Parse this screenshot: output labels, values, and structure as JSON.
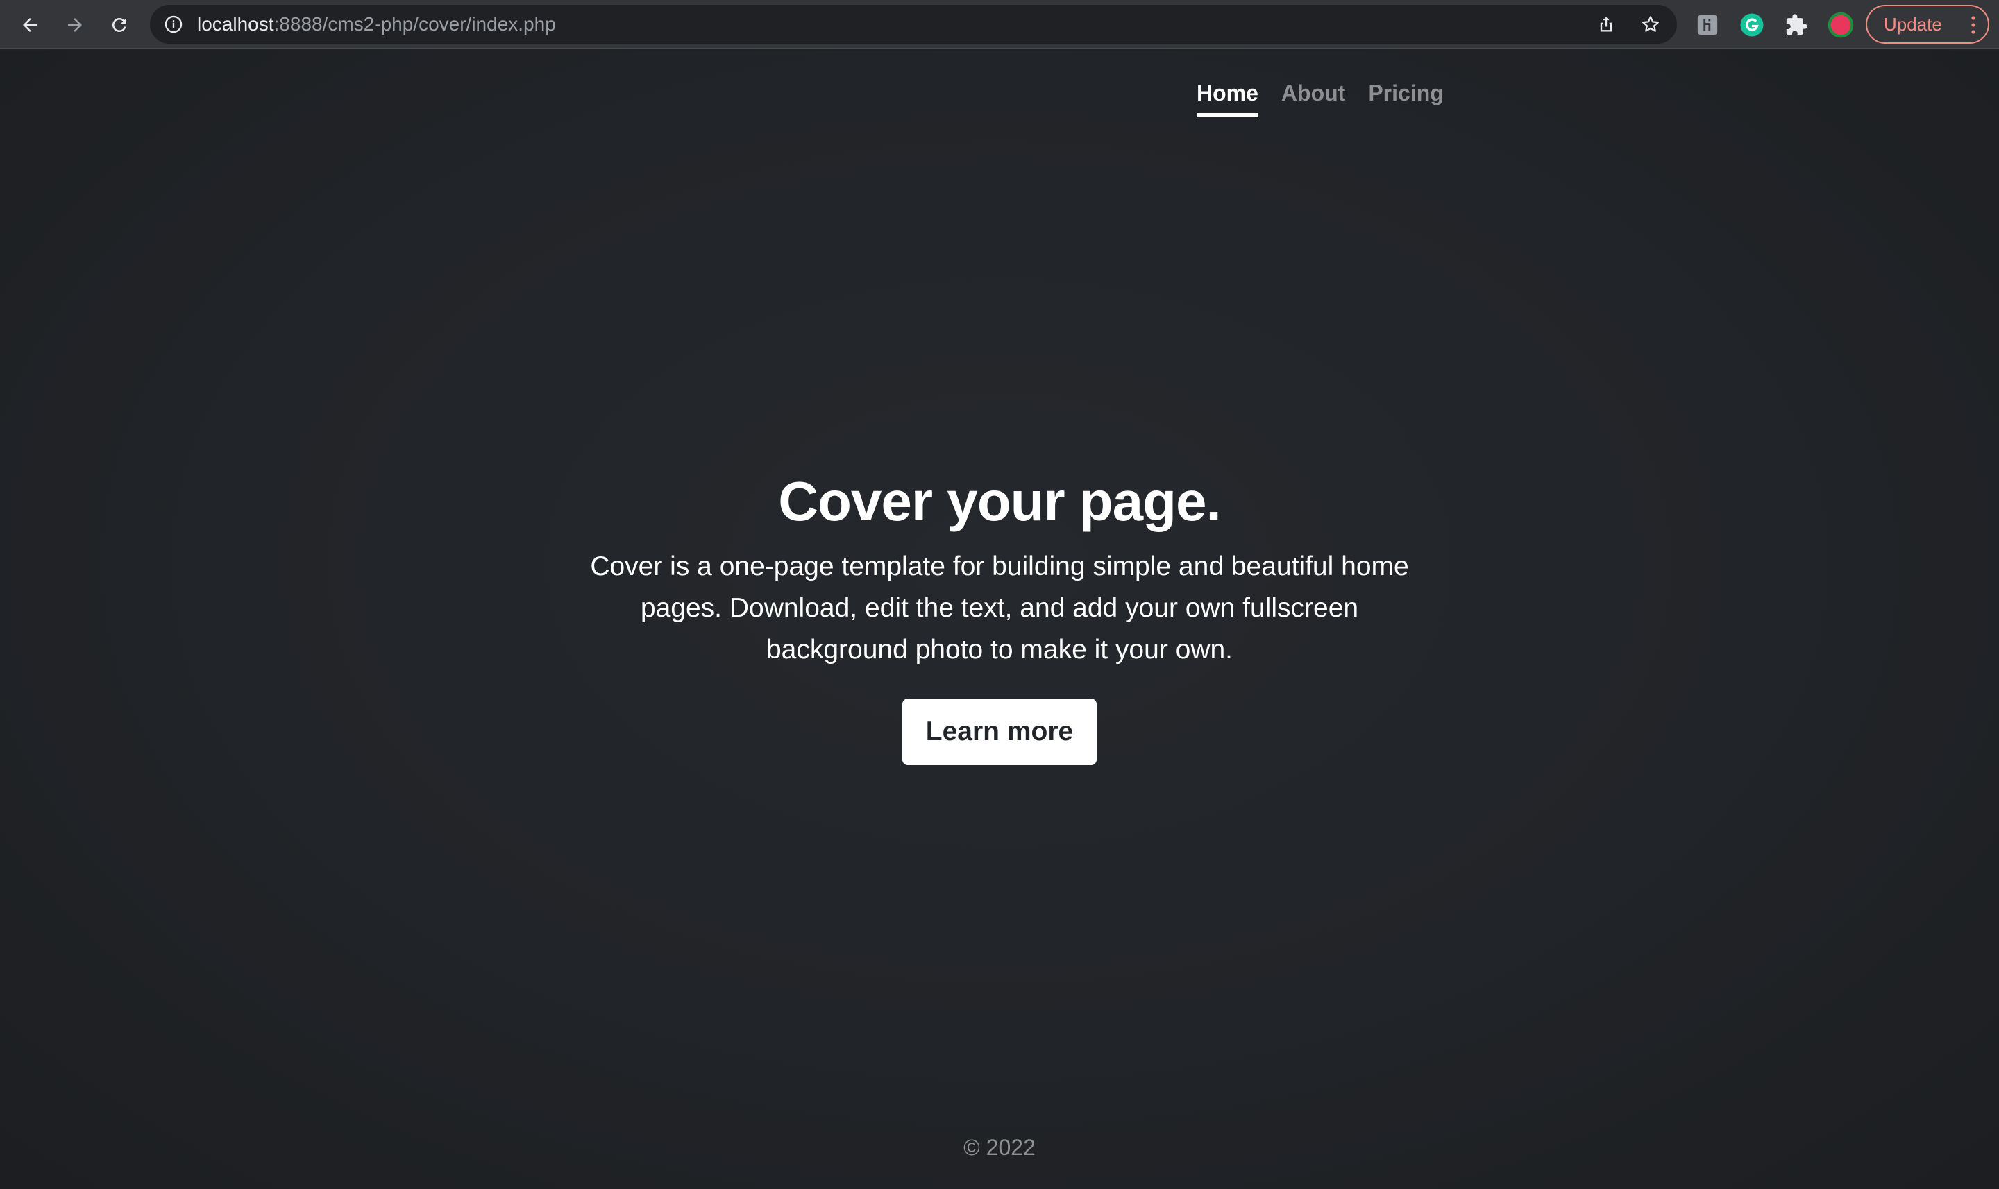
{
  "browser": {
    "url_host": "localhost",
    "url_rest": ":8888/cms2-php/cover/index.php",
    "update_label": "Update",
    "icons": [
      "back-arrow-icon",
      "forward-arrow-icon",
      "reload-icon",
      "info-icon",
      "share-icon",
      "star-icon",
      "extension-icon",
      "grammarly-icon",
      "puzzle-icon",
      "profile-avatar-icon",
      "more-vert-icon"
    ]
  },
  "nav": {
    "items": [
      {
        "label": "Home",
        "active": true
      },
      {
        "label": "About",
        "active": false
      },
      {
        "label": "Pricing",
        "active": false
      }
    ]
  },
  "hero": {
    "title": "Cover your page.",
    "lead": "Cover is a one-page template for building simple and beautiful home pages. Download, edit the text, and add your own fullscreen background photo to make it your own.",
    "button_label": "Learn more"
  },
  "footer": {
    "text": "© 2022"
  },
  "colors": {
    "background": "#212428",
    "text": "#ffffff",
    "muted": "#8e8f92",
    "update_accent": "#f28b82"
  }
}
